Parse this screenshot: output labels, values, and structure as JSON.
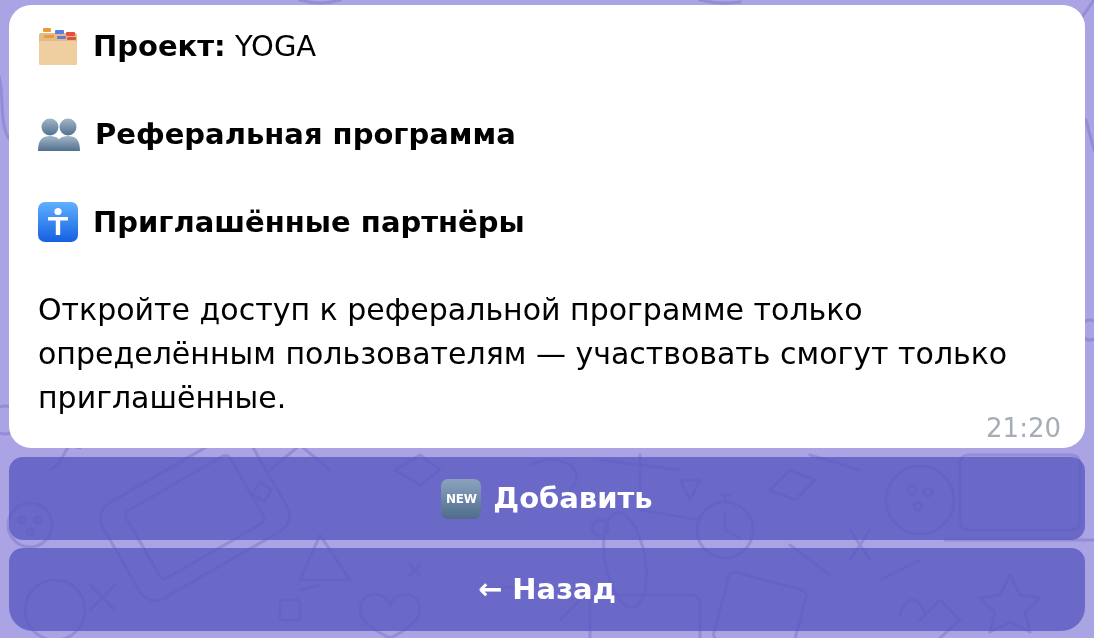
{
  "message": {
    "project": "**Проект:** YOGA",
    "section_title": "Реферальная программа",
    "subsection_title": "Приглашённые партнёры",
    "body": "Откройте доступ к реферальной программе только определённым пользователям — участвовать смогут только приглашённые.",
    "time": "21:20"
  },
  "buttons": [
    {
      "kind": "add",
      "tag": "NEW",
      "label": "Добавить"
    },
    {
      "kind": "back",
      "label": "← Назад"
    }
  ]
}
